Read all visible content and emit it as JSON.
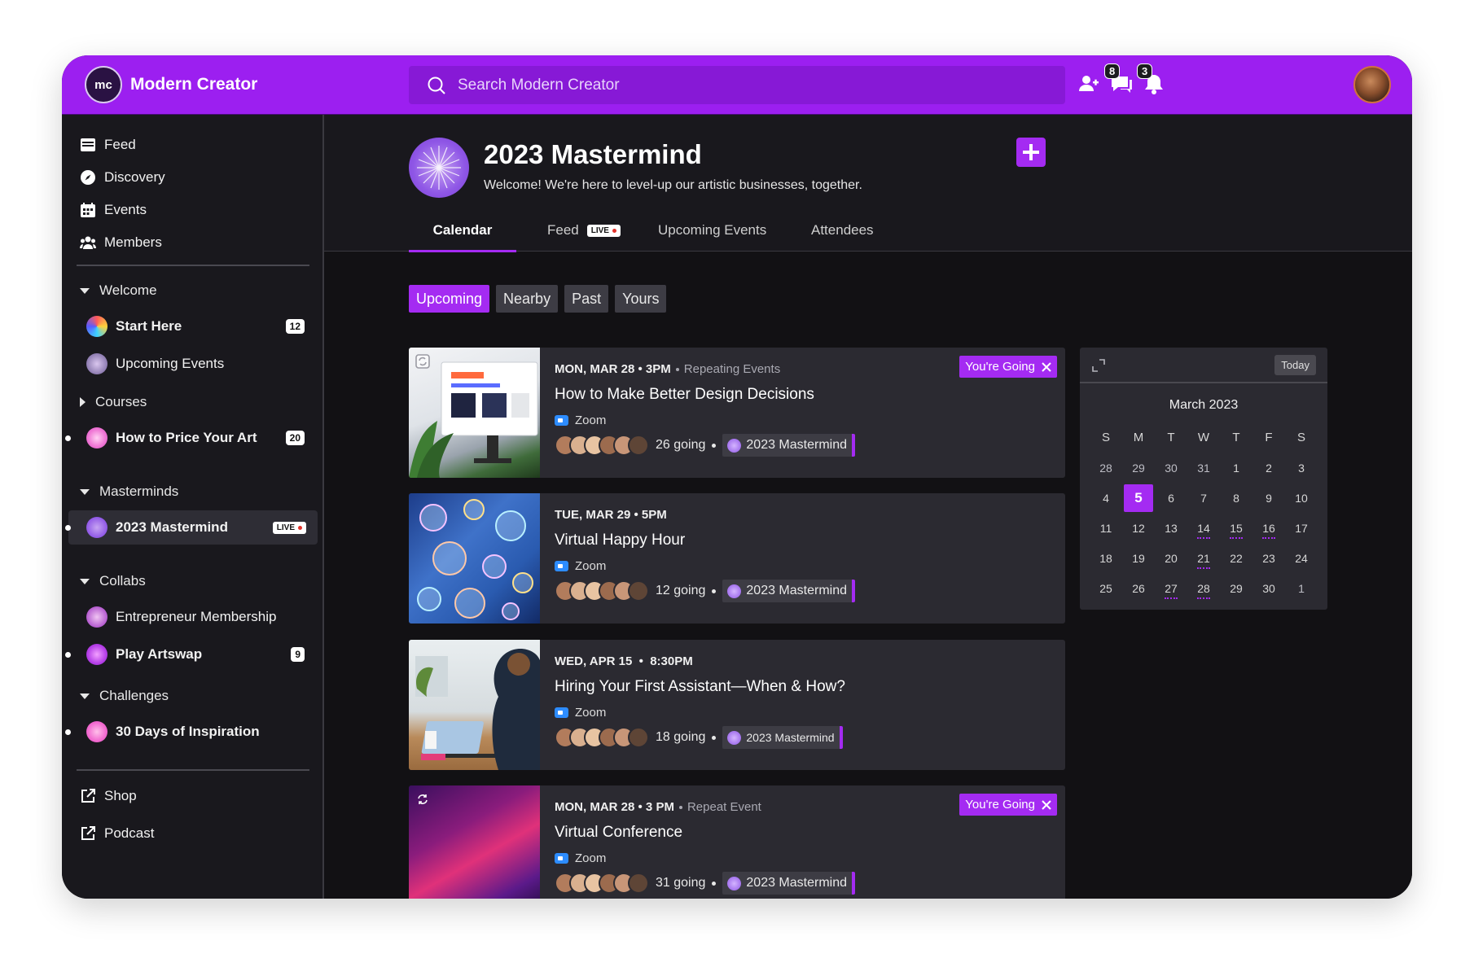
{
  "app": {
    "name": "Modern Creator",
    "logo_text": "mc",
    "search_placeholder": "Search Modern Creator",
    "chat_count": "8",
    "notification_count": "3"
  },
  "sidebar": {
    "nav": [
      {
        "label": "Feed",
        "icon": "feed-icon"
      },
      {
        "label": "Discovery",
        "icon": "compass-icon"
      },
      {
        "label": "Events",
        "icon": "calendar-icon"
      },
      {
        "label": "Members",
        "icon": "members-icon"
      }
    ],
    "sections": {
      "welcome": {
        "label": "Welcome"
      },
      "courses": {
        "label": "Courses"
      },
      "masterminds": {
        "label": "Masterminds"
      },
      "collabs": {
        "label": "Collabs"
      },
      "challenges": {
        "label": "Challenges"
      }
    },
    "spaces": {
      "start_here": {
        "label": "Start Here",
        "badge": "12"
      },
      "upcoming_events": {
        "label": "Upcoming Events"
      },
      "price_art": {
        "label": "How to Price Your Art",
        "badge": "20"
      },
      "mastermind": {
        "label": "2023 Mastermind",
        "live": "LIVE"
      },
      "entrepreneur": {
        "label": "Entrepreneur Membership"
      },
      "artswap": {
        "label": "Play Artswap",
        "badge": "9"
      },
      "inspiration": {
        "label": "30 Days of Inspiration"
      }
    },
    "links": [
      {
        "label": "Shop"
      },
      {
        "label": "Podcast"
      }
    ]
  },
  "space": {
    "title": "2023 Mastermind",
    "description": "Welcome! We're here to level-up our artistic businesses, together.",
    "tabs": [
      "Calendar",
      "Feed",
      "Upcoming Events",
      "Attendees"
    ],
    "feed_live": "LIVE",
    "filters": [
      "Upcoming",
      "Nearby",
      "Past",
      "Yours"
    ]
  },
  "events": [
    {
      "date": "MON, MAR 28 • 3PM",
      "sub": "Repeating Events",
      "title": "How to Make Better Design Decisions",
      "location": "Zoom",
      "going": "26 going",
      "group": "2023 Mastermind",
      "status": "You're Going"
    },
    {
      "date": "TUE, MAR 29 • 5PM",
      "title": "Virtual Happy Hour",
      "location": "Zoom",
      "going": "12 going",
      "group": "2023 Mastermind"
    },
    {
      "date": "WED, APR 15  •  8:30PM",
      "title": "Hiring Your First Assistant—When & How?",
      "location": "Zoom",
      "going": "18 going",
      "group": "2023 Mastermind"
    },
    {
      "date": "MON, MAR 28 • 3 PM",
      "sub": "Repeat Event",
      "title": "Virtual Conference",
      "location": "Zoom",
      "going": "31 going",
      "group": "2023 Mastermind",
      "status": "You're Going"
    }
  ],
  "calendar": {
    "today_label": "Today",
    "month": "March 2023",
    "weekdays": [
      "S",
      "M",
      "T",
      "W",
      "T",
      "F",
      "S"
    ],
    "days": [
      "28",
      "29",
      "30",
      "31",
      "1",
      "2",
      "3",
      "4",
      "5",
      "6",
      "7",
      "8",
      "9",
      "10",
      "11",
      "12",
      "13",
      "14",
      "15",
      "16",
      "17",
      "18",
      "19",
      "20",
      "21",
      "22",
      "23",
      "24",
      "25",
      "26",
      "27",
      "28",
      "29",
      "30",
      "1"
    ],
    "selected_day": "5"
  },
  "colors": {
    "accent": "#a42bf2",
    "topbar": "#9c1ff0",
    "sidebar": "#19181d",
    "card": "#2b2a31"
  }
}
